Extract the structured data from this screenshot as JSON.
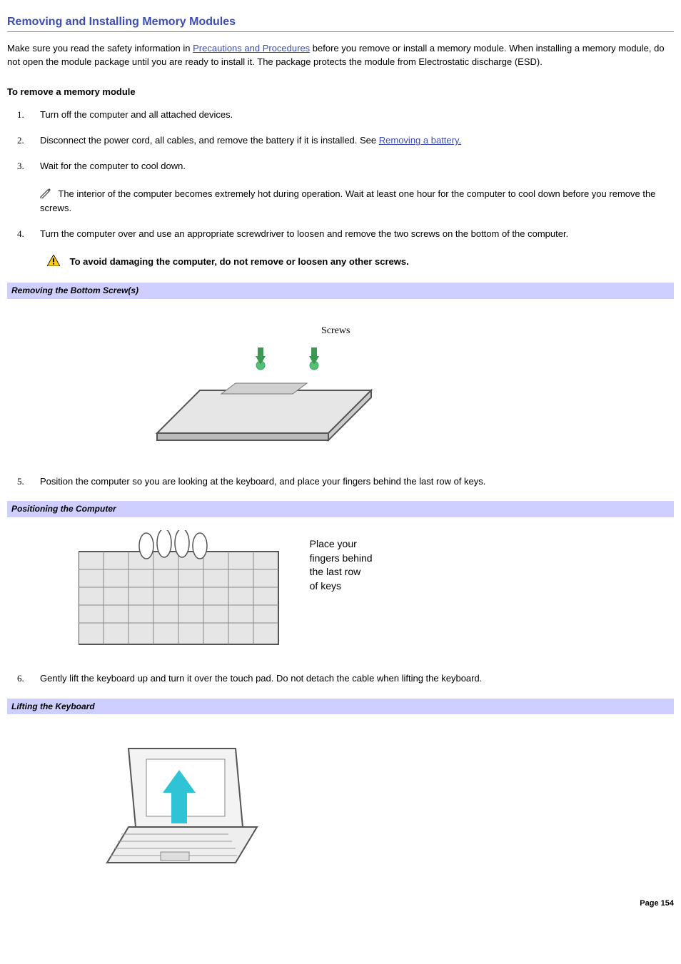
{
  "title": "Removing and Installing Memory Modules",
  "intro": {
    "part1": "Make sure you read the safety information in ",
    "link1": "Precautions and Procedures",
    "part2": " before you remove or install a memory module. When installing a memory module, do not open the module package until you are ready to install it. The package protects the module from Electrostatic discharge (ESD)."
  },
  "sub1": "To remove a memory module",
  "steps": {
    "s1": "Turn off the computer and all attached devices.",
    "s2a": "Disconnect the power cord, all cables, and remove the battery if it is installed. See ",
    "s2link": "Removing a battery.",
    "s3": "Wait for the computer to cool down.",
    "s3note": "The interior of the computer becomes extremely hot during operation. Wait at least one hour for the computer to cool down before you remove the screws.",
    "s4": "Turn the computer over and use an appropriate screwdriver to loosen and remove the two screws on the bottom of the computer.",
    "s4warn": "To avoid damaging the computer, do not remove or loosen any other screws.",
    "s5": "Position the computer so you are looking at the keyboard, and place your fingers behind the last row of keys.",
    "s6": "Gently lift the keyboard up and turn it over the touch pad. Do not detach the cable when lifting the keyboard."
  },
  "captions": {
    "c1": "Removing the Bottom Screw(s)",
    "c2": "Positioning the Computer",
    "c3": "Lifting the Keyboard"
  },
  "fig_labels": {
    "screws": "Screws",
    "fingers": "Place your\nfingers behind\nthe last row\nof keys"
  },
  "page_number": "Page 154"
}
